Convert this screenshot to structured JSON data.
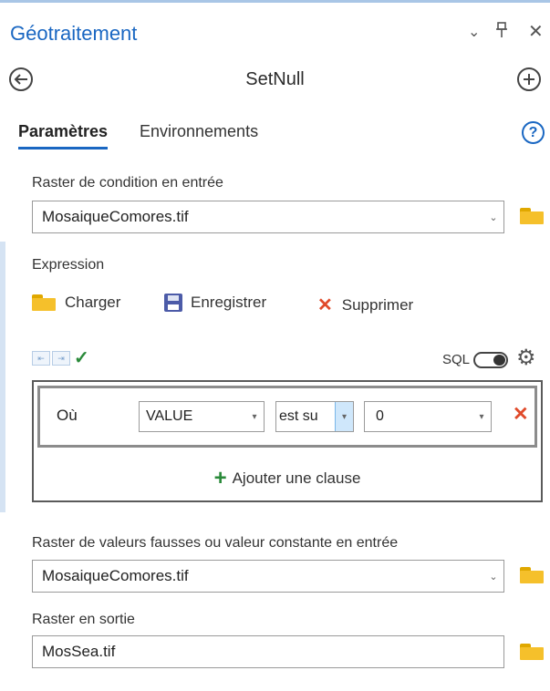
{
  "panel": {
    "title": "Géotraitement",
    "controls": {
      "dropdown": "⌄",
      "pin": "ᵖ",
      "close": "✕"
    }
  },
  "tool": {
    "name": "SetNull",
    "back_icon": "back-arrow-icon",
    "add_icon": "add-circle-icon"
  },
  "tabs": [
    {
      "label": "Paramètres",
      "active": true
    },
    {
      "label": "Environnements",
      "active": false
    }
  ],
  "help_label": "?",
  "params": {
    "condition_raster": {
      "label": "Raster de condition en entrée",
      "value": "MosaiqueComores.tif"
    },
    "expression": {
      "label": "Expression",
      "actions": {
        "load": "Charger",
        "save": "Enregistrer",
        "delete": "Supprimer"
      },
      "sql_label": "SQL",
      "sql_enabled": false,
      "clause": {
        "where_label": "Où",
        "field": "VALUE",
        "operator": "est su",
        "value": "0"
      },
      "add_clause_label": "Ajouter une clause"
    },
    "false_raster": {
      "label": "Raster de valeurs fausses ou valeur constante en entrée",
      "value": "MosaiqueComores.tif"
    },
    "output_raster": {
      "label": "Raster en sortie",
      "value": "MosSea.tif"
    }
  },
  "colors": {
    "accent": "#1a67c2",
    "folder": "#f5c02b",
    "delete": "#e04a2a",
    "valid": "#2a8a3a"
  }
}
